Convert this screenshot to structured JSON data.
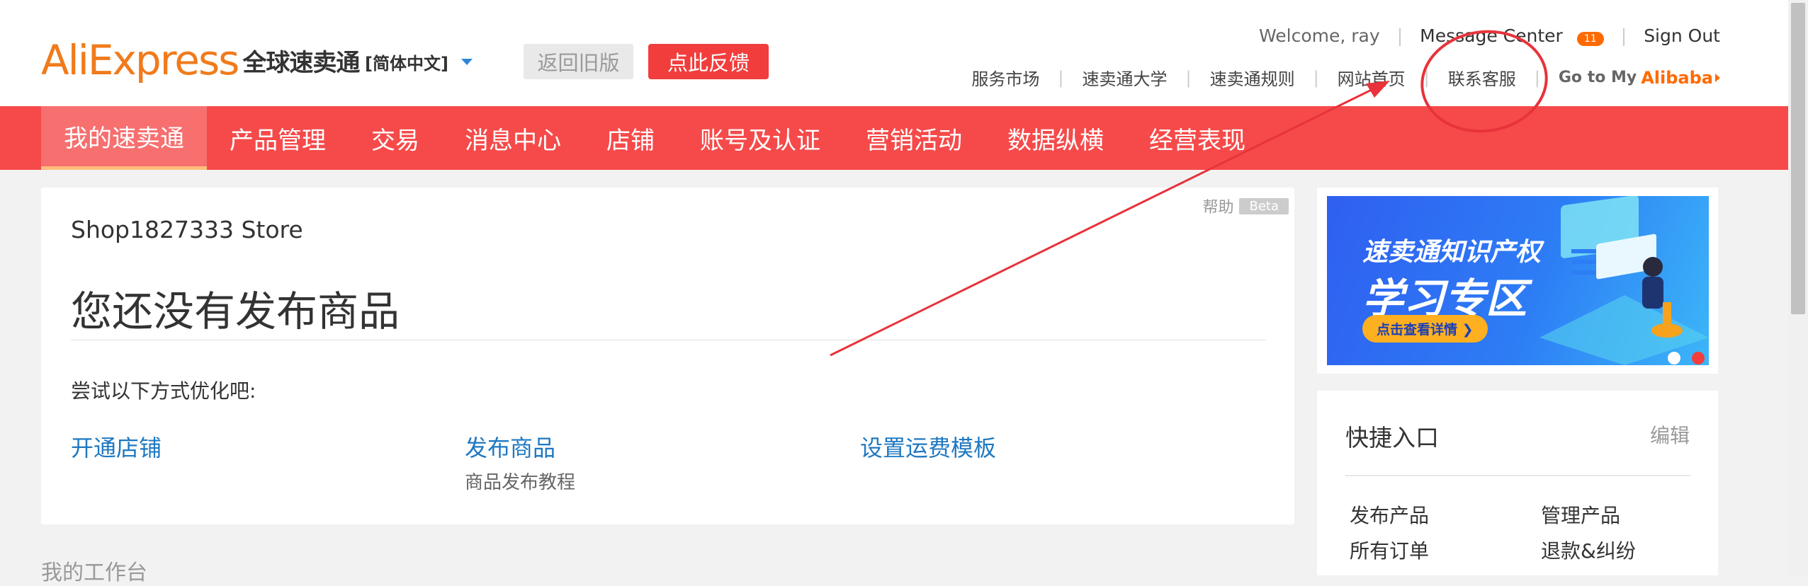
{
  "header": {
    "logo_text": "AliExpress",
    "logo_sub": "全球速卖通",
    "language": "[简体中文]",
    "old_version": "返回旧版",
    "feedback": "点此反馈",
    "welcome": "Welcome, ray",
    "message_center": "Message Center",
    "message_count": "11",
    "sign_out": "Sign Out",
    "sublinks": [
      "服务市场",
      "速卖通大学",
      "速卖通规则",
      "网站首页",
      "联系客服"
    ],
    "goto_prefix": "Go to My",
    "goto_brand": "Alibaba"
  },
  "nav": {
    "items": [
      "我的速卖通",
      "产品管理",
      "交易",
      "消息中心",
      "店铺",
      "账号及认证",
      "营销活动",
      "数据纵横",
      "经营表现"
    ],
    "active_index": 0
  },
  "main": {
    "help": "帮助",
    "beta": "Beta",
    "store_name": "Shop1827333 Store",
    "empty_title": "您还没有发布商品",
    "try_text": "尝试以下方式优化吧:",
    "actions": [
      {
        "label": "开通店铺",
        "sub": ""
      },
      {
        "label": "发布商品",
        "sub": "商品发布教程"
      },
      {
        "label": "设置运费模板",
        "sub": ""
      }
    ],
    "workbench": "我的工作台"
  },
  "banner": {
    "line1": "速卖通知识产权",
    "line2": "学习专区",
    "cta": "点击查看详情 ❯",
    "slide_count": 2,
    "active_slide": 1
  },
  "quick": {
    "title": "快捷入口",
    "edit": "编辑",
    "links": [
      "发布产品",
      "管理产品",
      "所有订单",
      "退款&纠纷"
    ]
  },
  "colors": {
    "nav_bg": "#f64a4a",
    "accent": "#f23d3d",
    "link": "#1f78c1",
    "annotation": "#e8333a"
  }
}
